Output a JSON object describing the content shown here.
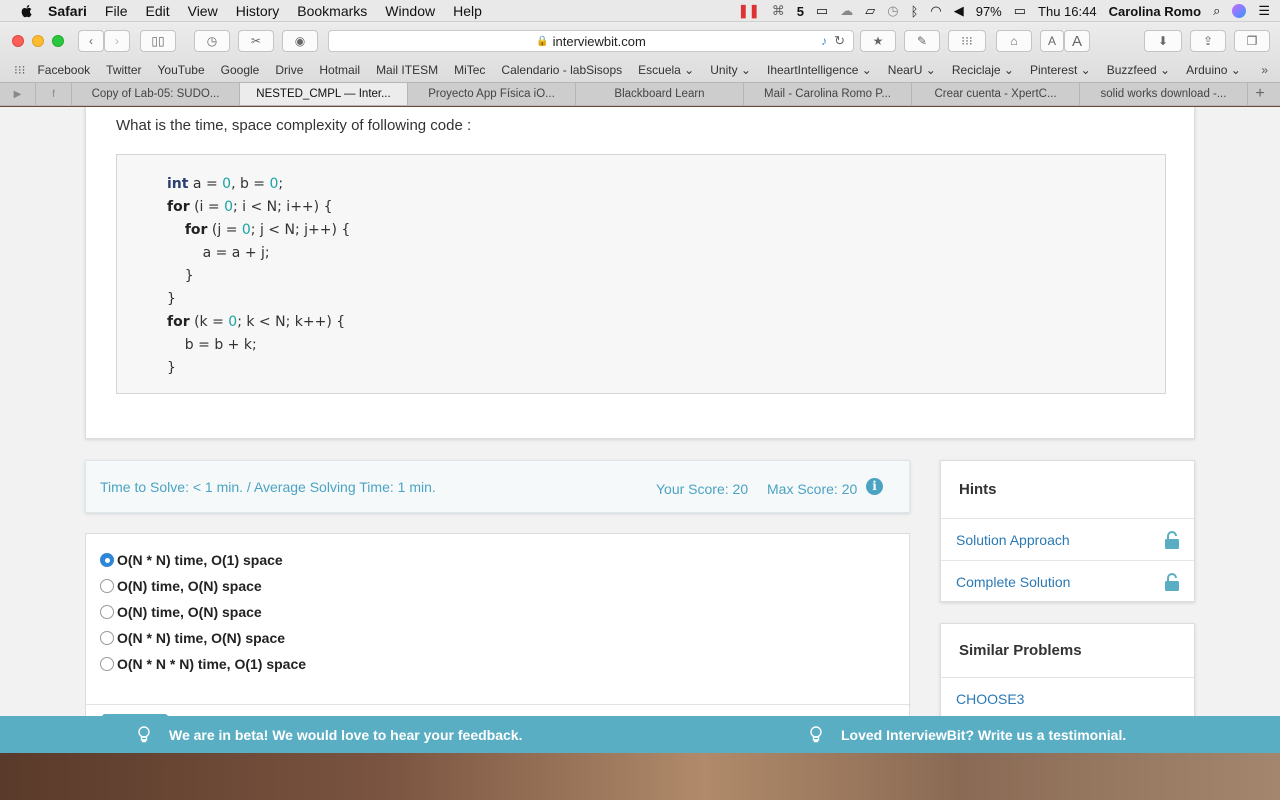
{
  "menubar": {
    "app": "Safari",
    "items": [
      "File",
      "Edit",
      "View",
      "History",
      "Bookmarks",
      "Window",
      "Help"
    ],
    "battery": "97%",
    "clock": "Thu 16:44",
    "user": "Carolina Romo",
    "badge": "5"
  },
  "toolbar": {
    "url": "interviewbit.com"
  },
  "favorites": [
    "Facebook",
    "Twitter",
    "YouTube",
    "Google",
    "Drive",
    "Hotmail",
    "Mail ITESM",
    "MiTec",
    "Calendario - labSisops",
    "Escuela ⌄",
    "Unity ⌄",
    "IheartIntelligence ⌄",
    "NearU ⌄",
    "Reciclaje ⌄",
    "Pinterest ⌄",
    "Buzzfeed ⌄",
    "Arduino ⌄"
  ],
  "tabs": [
    {
      "label": "Copy of Lab-05: SUDO..."
    },
    {
      "label": "NESTED_CMPL — Inter..."
    },
    {
      "label": "Proyecto App Física iO..."
    },
    {
      "label": "Blackboard Learn"
    },
    {
      "label": "Mail - Carolina Romo P..."
    },
    {
      "label": "Crear cuenta - XpertC..."
    },
    {
      "label": "solid works download -..."
    }
  ],
  "question": {
    "title": "What is the time, space complexity of following code :",
    "code": [
      "int a = 0, b = 0;",
      "for (i = 0; i < N; i++) {",
      "    for (j = 0; j < N; j++) {",
      "        a = a + j;",
      "    }",
      "}",
      "for (k = 0; k < N; k++) {",
      "    b = b + k;",
      "}"
    ]
  },
  "timing": {
    "time_text": "Time to Solve: < 1 min. / Average Solving Time: 1 min.",
    "your_score": "Your Score: 20",
    "max_score": "Max Score: 20"
  },
  "options": [
    {
      "label": "O(N * N) time, O(1) space",
      "selected": true
    },
    {
      "label": "O(N) time, O(N) space",
      "selected": false
    },
    {
      "label": "O(N) time, O(N) space",
      "selected": false
    },
    {
      "label": "O(N * N) time, O(N) space",
      "selected": false
    },
    {
      "label": "O(N * N * N) time, O(1) space",
      "selected": false
    }
  ],
  "hints": {
    "title": "Hints",
    "items": [
      "Solution Approach",
      "Complete Solution"
    ]
  },
  "similar": {
    "title": "Similar Problems",
    "items": [
      "CHOOSE3"
    ]
  },
  "banner": {
    "left": "We are in beta! We would love to hear your feedback.",
    "right": "Loved InterviewBit? Write us a testimonial."
  }
}
